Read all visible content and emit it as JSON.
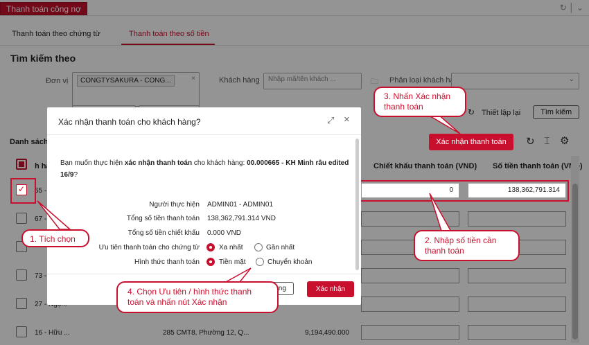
{
  "window": {
    "title": "Thanh toán công nợ"
  },
  "subtabs": [
    "Thanh toán theo chứng từ",
    "Thanh toán theo số tiền"
  ],
  "search": {
    "heading": "Tìm kiếm theo",
    "unit_label": "Đơn vị",
    "unit_value": "CONGTYSAKURA - CONG...",
    "customer_label": "Khách hàng",
    "customer_placeholder": "Nhập mã/tên khách ...",
    "category_label": "Phân loại khách hà",
    "reset_label": "Thiết lập lại",
    "search_button": "Tìm kiếm"
  },
  "list": {
    "heading": "Danh sách",
    "confirm_button": "Xác nhận thanh toán",
    "col_customer": "h hà",
    "col_discount": "Chiết khấu thanh toán (VND)",
    "col_amount": "Số tiền thanh toán (VND)",
    "rows": [
      {
        "name": "65 -",
        "address": "",
        "amount": "",
        "discount": "0",
        "pay": "138,362,791.314"
      },
      {
        "name": "67 -",
        "address": "",
        "amount": "",
        "discount": "",
        "pay": ""
      },
      {
        "name": "",
        "address": "",
        "amount": "",
        "discount": "",
        "pay": ""
      },
      {
        "name": "73 -",
        "address": "",
        "amount": "",
        "discount": "",
        "pay": ""
      },
      {
        "name": "27 - Ngọ...",
        "address": "",
        "amount": "",
        "discount": "",
        "pay": ""
      },
      {
        "name": "16 - Hữu ...",
        "address": "285 CMT8, Phường 12, Q...",
        "amount": "9,194,490.000",
        "discount": "",
        "pay": ""
      }
    ]
  },
  "modal": {
    "title": "Xác nhận thanh toán cho khách hàng?",
    "message_pre": "Bạn muốn thực hiện ",
    "message_bold": "xác nhận thanh toán",
    "message_mid": " cho khách hàng: ",
    "message_customer": "00.000665 - KH Minh râu edited 16/9",
    "message_end": "?",
    "fields": [
      {
        "label": "Người thực hiện",
        "value": "ADMIN01 - ADMIN01"
      },
      {
        "label": "Tổng số tiền thanh toán",
        "value": "138,362,791.314  VND"
      },
      {
        "label": "Tổng số tiền chiết khấu",
        "value": "0.000  VND"
      }
    ],
    "priority_label": "Ưu tiên thanh toán cho chứng từ",
    "priority_options": [
      "Xa nhất",
      "Gần nhất"
    ],
    "method_label": "Hình thức thanh toán",
    "method_options": [
      "Tiền mặt",
      "Chuyển khoản"
    ],
    "close_button": "Đóng",
    "confirm_button": "Xác nhận"
  },
  "callouts": {
    "c1": "1. Tích chọn",
    "c2": "2. Nhập số tiền cần thanh toán",
    "c3": "3. Nhấn Xác nhận thanh toán",
    "c4": "4. Chọn Ưu tiên / hình thức thanh toán và nhấn nút Xác nhận"
  },
  "colors": {
    "accent": "#c8102e"
  }
}
